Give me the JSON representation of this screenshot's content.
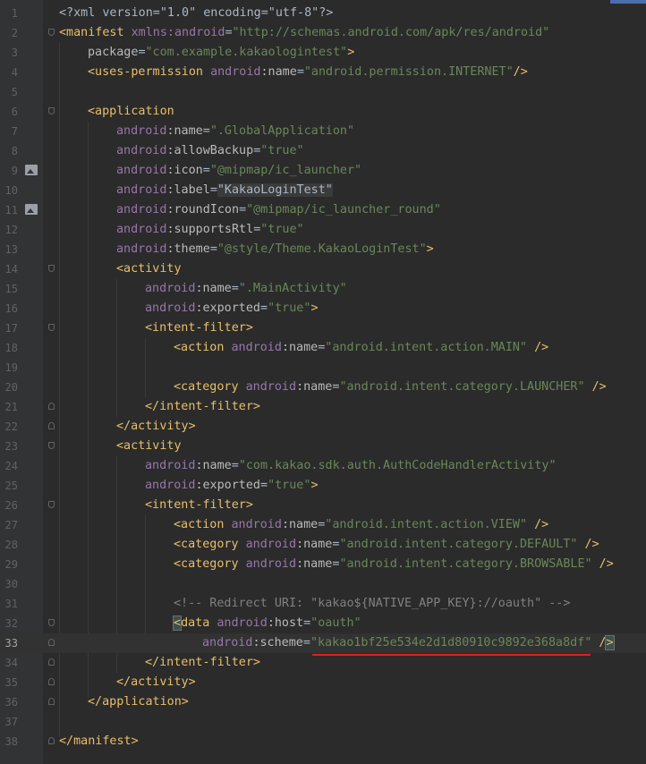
{
  "editor": {
    "file_content": {
      "l1": "<?xml version=\"1.0\" encoding=\"utf-8\"?>",
      "l2_tag": "<manifest",
      "l2_ns": "xmlns:android",
      "l2_val": "\"http://schemas.android.com/apk/res/android\"",
      "l3_attr": "package",
      "l3_val": "\"com.example.kakaologintest\"",
      "l4_tag": "<uses-permission",
      "l4_ns": "android",
      "l4_attr": ":name",
      "l4_val": "\"android.permission.INTERNET\"",
      "l4_end": "/>",
      "l6_tag": "<application",
      "l7": {
        "ns": "android",
        "attr": ":name",
        "val": "\".GlobalApplication\""
      },
      "l8": {
        "ns": "android",
        "attr": ":allowBackup",
        "val": "\"true\""
      },
      "l9": {
        "ns": "android",
        "attr": ":icon",
        "val": "\"@mipmap/ic_launcher\""
      },
      "l10": {
        "ns": "android",
        "attr": ":label",
        "val": "\"KakaoLoginTest\""
      },
      "l11": {
        "ns": "android",
        "attr": ":roundIcon",
        "val": "\"@mipmap/ic_launcher_round\""
      },
      "l12": {
        "ns": "android",
        "attr": ":supportsRtl",
        "val": "\"true\""
      },
      "l13": {
        "ns": "android",
        "attr": ":theme",
        "val": "\"@style/Theme.KakaoLoginTest\"",
        "end": ">"
      },
      "l14_tag": "<activity",
      "l15": {
        "ns": "android",
        "attr": ":name",
        "val": "\".MainActivity\""
      },
      "l16": {
        "ns": "android",
        "attr": ":exported",
        "val": "\"true\"",
        "end": ">"
      },
      "l17_tag": "<intent-filter>",
      "l18": {
        "tag": "<action",
        "ns": "android",
        "attr": ":name",
        "val": "\"android.intent.action.MAIN\"",
        "end": " />"
      },
      "l20": {
        "tag": "<category",
        "ns": "android",
        "attr": ":name",
        "val": "\"android.intent.category.LAUNCHER\"",
        "end": " />"
      },
      "l21_tag": "</intent-filter>",
      "l22_tag": "</activity>",
      "l23_tag": "<activity",
      "l24": {
        "ns": "android",
        "attr": ":name",
        "val": "\"com.kakao.sdk.auth.AuthCodeHandlerActivity\""
      },
      "l25": {
        "ns": "android",
        "attr": ":exported",
        "val": "\"true\"",
        "end": ">"
      },
      "l26_tag": "<intent-filter>",
      "l27": {
        "tag": "<action",
        "ns": "android",
        "attr": ":name",
        "val": "\"android.intent.action.VIEW\"",
        "end": " />"
      },
      "l28": {
        "tag": "<category",
        "ns": "android",
        "attr": ":name",
        "val": "\"android.intent.category.DEFAULT\"",
        "end": " />"
      },
      "l29": {
        "tag": "<category",
        "ns": "android",
        "attr": ":name",
        "val": "\"android.intent.category.BROWSABLE\"",
        "end": " />"
      },
      "l31_comment": "<!-- Redirect URI: \"kakao${NATIVE_APP_KEY}://oauth\" -->",
      "l32": {
        "tag_lt": "<",
        "tag": "data",
        "ns": "android",
        "attr": ":host",
        "val": "\"oauth\""
      },
      "l33": {
        "ns": "android",
        "attr": ":scheme",
        "val": "\"kakao1bf25e534e2d1d80910c9892e368a8df\"",
        "end_a": "/",
        "end_b": ">"
      },
      "l34_tag": "</intent-filter>",
      "l35_tag": "</activity>",
      "l36_tag": "</application>",
      "l38_tag": "</manifest>"
    },
    "line_numbers": [
      "1",
      "2",
      "3",
      "4",
      "5",
      "6",
      "7",
      "8",
      "9",
      "10",
      "11",
      "12",
      "13",
      "14",
      "15",
      "16",
      "17",
      "18",
      "19",
      "20",
      "21",
      "22",
      "23",
      "24",
      "25",
      "26",
      "27",
      "28",
      "29",
      "30",
      "31",
      "32",
      "33",
      "34",
      "35",
      "36",
      "37",
      "38"
    ],
    "colors": {
      "background": "#2b2b2b",
      "gutter": "#313335",
      "tag": "#e8bf6a",
      "namespace": "#9876aa",
      "value": "#6a8759",
      "comment": "#808080",
      "annotation_underline": "#e0201b"
    }
  }
}
